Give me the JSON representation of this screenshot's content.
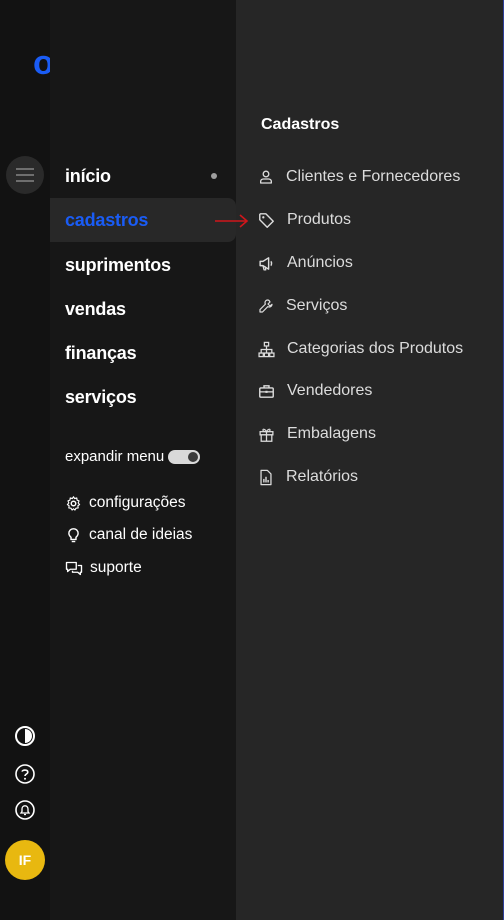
{
  "brand": {
    "logo_text": "olist",
    "logo_color": "#1a5cf5"
  },
  "main_menu": {
    "items": [
      {
        "label": "início",
        "active": false,
        "has_dot": true
      },
      {
        "label": "cadastros",
        "active": true,
        "has_dot": false
      },
      {
        "label": "suprimentos",
        "active": false,
        "has_dot": false
      },
      {
        "label": "vendas",
        "active": false,
        "has_dot": false
      },
      {
        "label": "finanças",
        "active": false,
        "has_dot": false
      },
      {
        "label": "serviços",
        "active": false,
        "has_dot": false
      }
    ],
    "expand_label": "expandir menu",
    "expand_toggle_on": true,
    "utilities": [
      {
        "label": "configurações",
        "icon": "gear-icon"
      },
      {
        "label": "canal de ideias",
        "icon": "lightbulb-icon"
      },
      {
        "label": "suporte",
        "icon": "chat-icon"
      }
    ]
  },
  "rail": {
    "icons": [
      "contrast-icon",
      "help-icon",
      "bell-icon"
    ],
    "avatar_initials": "IF",
    "avatar_color": "#e8b810"
  },
  "submenu": {
    "title": "Cadastros",
    "items": [
      {
        "label": "Clientes e Fornecedores",
        "icon": "user-icon"
      },
      {
        "label": "Produtos",
        "icon": "tag-icon"
      },
      {
        "label": "Anúncios",
        "icon": "megaphone-icon"
      },
      {
        "label": "Serviços",
        "icon": "wrench-icon"
      },
      {
        "label": "Categorias dos Produtos",
        "icon": "sitemap-icon"
      },
      {
        "label": "Vendedores",
        "icon": "briefcase-icon"
      },
      {
        "label": "Embalagens",
        "icon": "gift-icon"
      },
      {
        "label": "Relatórios",
        "icon": "report-icon"
      }
    ]
  },
  "annotation": {
    "arrow_color": "#d0161b",
    "points_to": "Produtos"
  }
}
